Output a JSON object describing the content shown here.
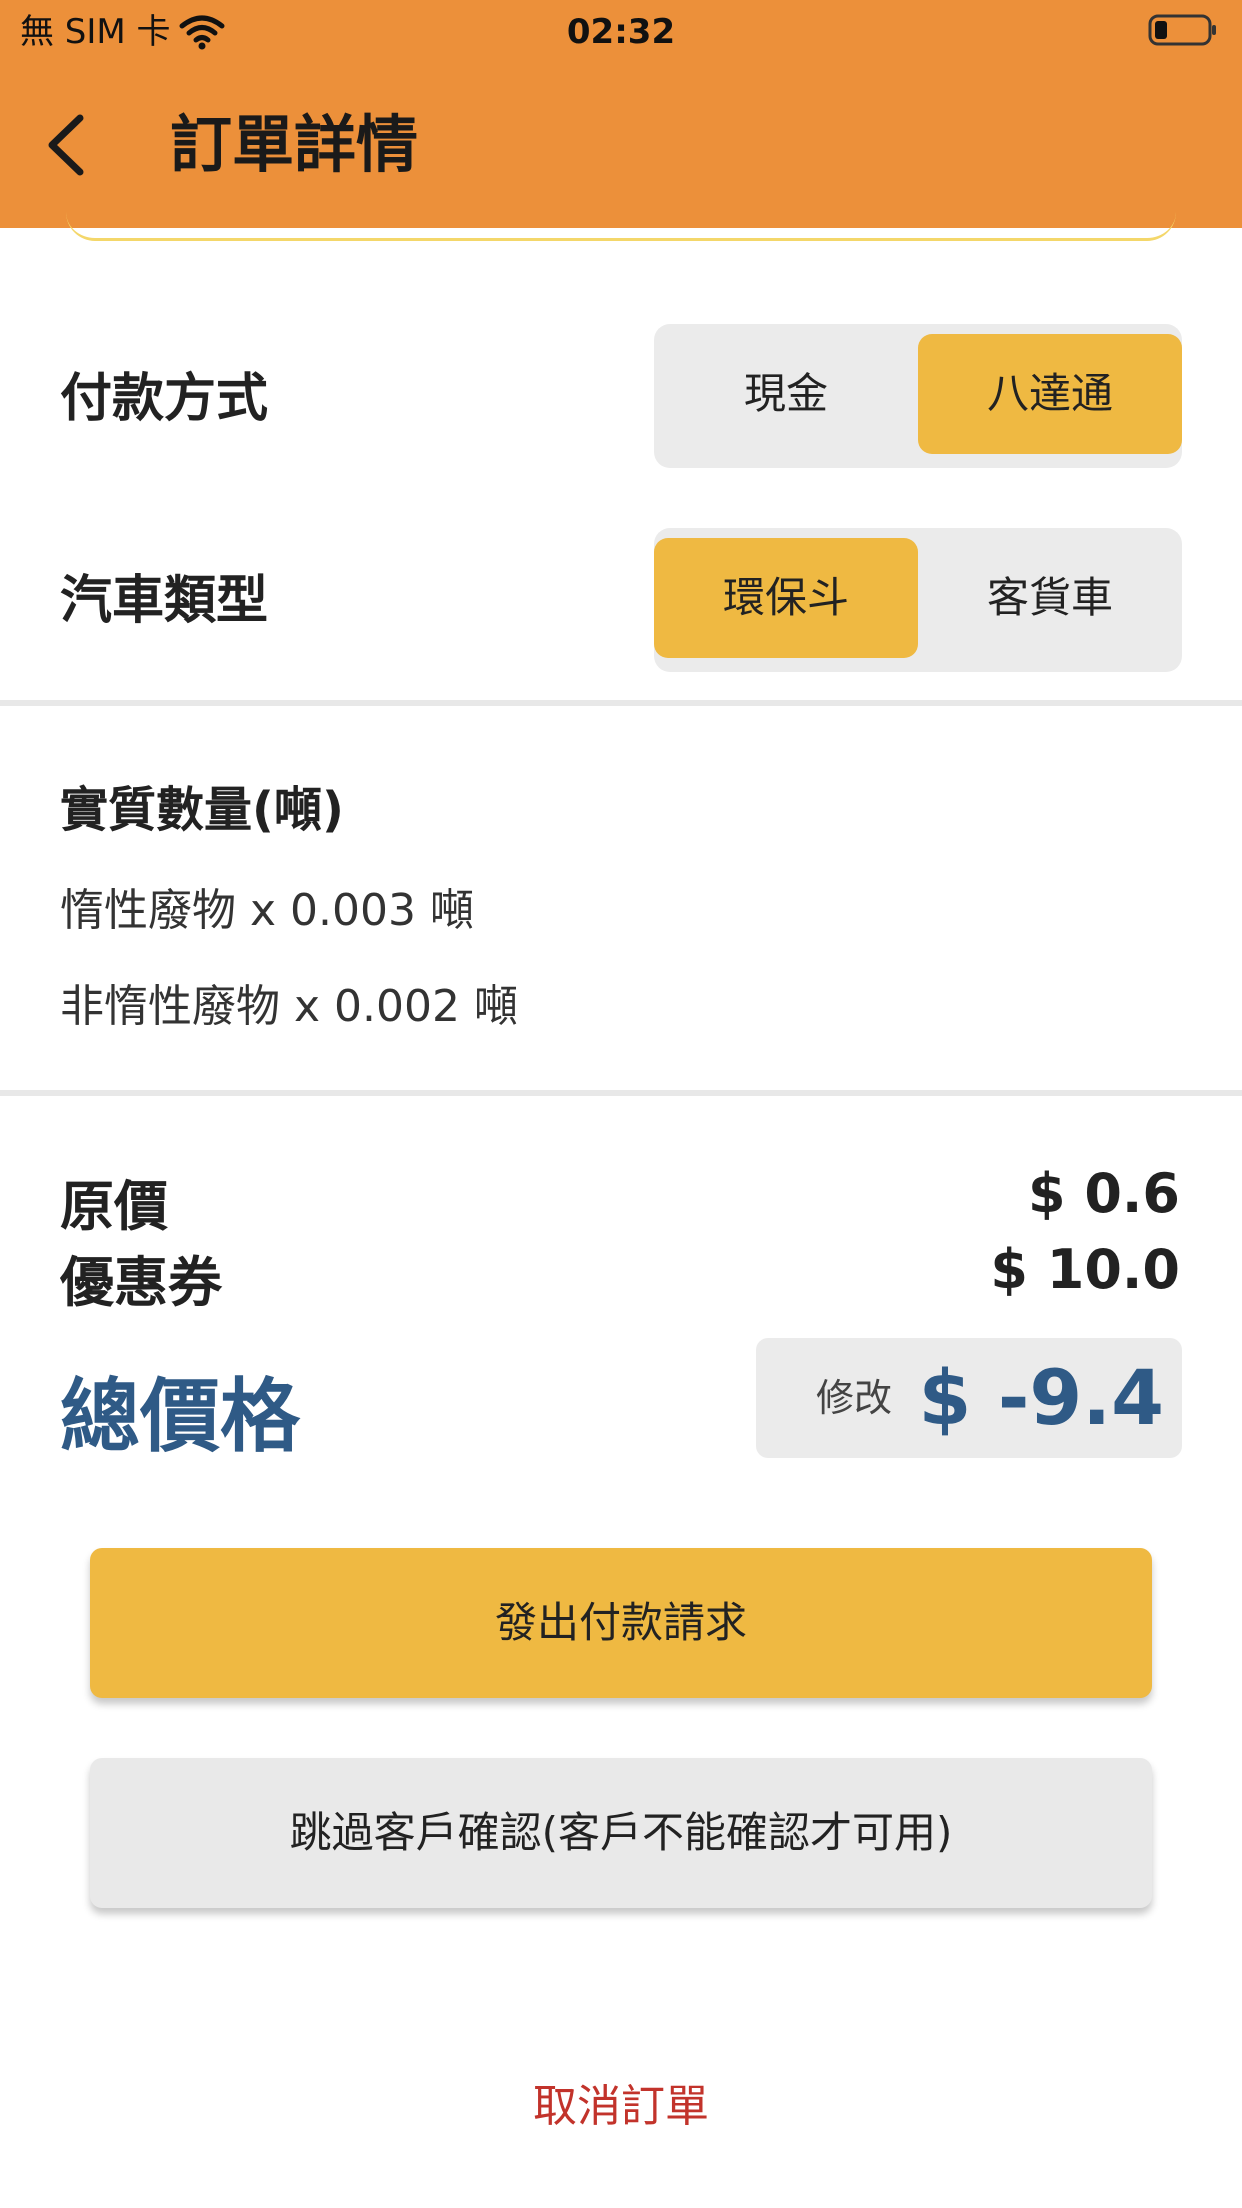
{
  "status_bar": {
    "carrier": "無 SIM 卡",
    "time": "02:32"
  },
  "header": {
    "title": "訂單詳情"
  },
  "payment": {
    "label": "付款方式",
    "options": [
      "現金",
      "八達通"
    ],
    "selected": "八達通"
  },
  "vehicle": {
    "label": "汽車類型",
    "options": [
      "環保斗",
      "客貨車"
    ],
    "selected": "環保斗"
  },
  "quantity": {
    "title": "實質數量(噸)",
    "items": [
      "惰性廢物 x 0.003 噸",
      "非惰性廢物 x 0.002 噸"
    ]
  },
  "prices": {
    "original_label": "原價",
    "original_value": "$ 0.6",
    "coupon_label": "優惠券",
    "coupon_value": "$ 10.0",
    "total_label": "總價格",
    "modify_label": "修改",
    "total_value": "$ -9.4"
  },
  "actions": {
    "pay_request": "發出付款請求",
    "skip_confirm": "跳過客戶確認(客戶不能確認才可用)",
    "cancel_order": "取消訂單"
  },
  "colors": {
    "header_bg": "#ec903a",
    "accent_yellow": "#efb942",
    "total_blue": "#2f5a86",
    "cancel_red": "#c2332b"
  }
}
